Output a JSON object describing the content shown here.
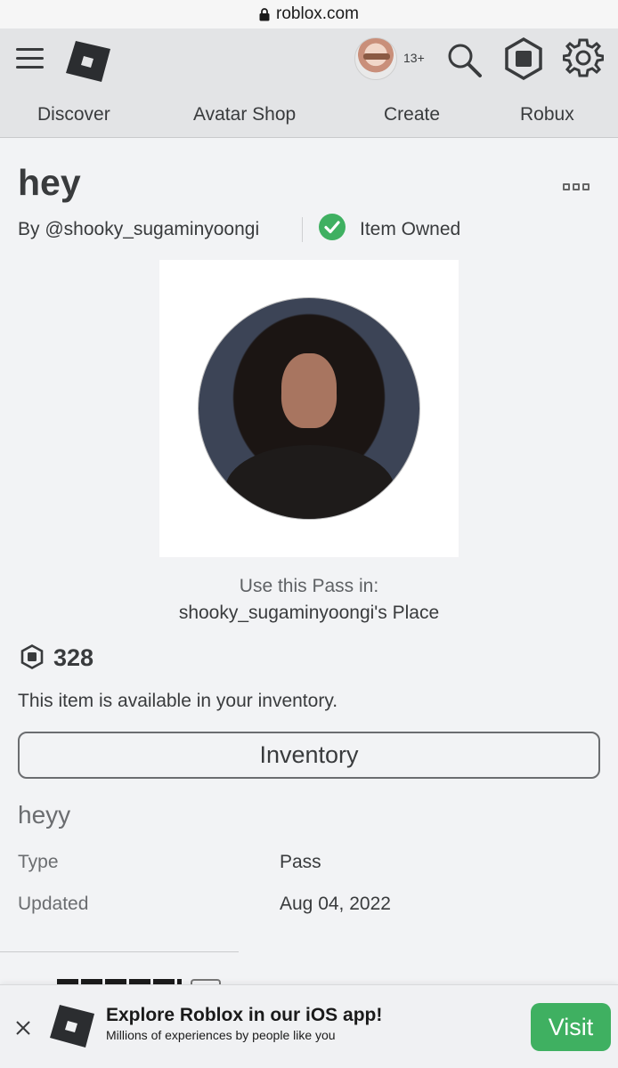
{
  "browser": {
    "url": "roblox.com"
  },
  "header": {
    "age_badge": "13+"
  },
  "nav": {
    "tabs": [
      "Discover",
      "Avatar Shop",
      "Create",
      "Robux"
    ]
  },
  "item": {
    "title": "hey",
    "creator": "By @shooky_sugaminyoongi",
    "owned_label": "Item Owned",
    "use_pass_label": "Use this Pass in:",
    "place_name": "shooky_sugaminyoongi's Place",
    "price": "328",
    "availability": "This item is available in your inventory.",
    "inventory_button": "Inventory",
    "description": "heyy",
    "details": [
      {
        "label": "Type",
        "value": "Pass"
      },
      {
        "label": "Updated",
        "value": "Aug 04, 2022"
      }
    ]
  },
  "banner": {
    "title": "Explore Roblox in our iOS app!",
    "subtitle": "Millions of experiences by people like you",
    "visit_label": "Visit"
  },
  "colors": {
    "accent_green": "#3fb061",
    "header_bg": "#e3e4e6",
    "page_bg": "#f2f3f5"
  },
  "icons": [
    "lock-icon",
    "menu-icon",
    "roblox-logo-icon",
    "search-icon",
    "robux-icon",
    "gear-icon",
    "more-icon",
    "check-icon",
    "close-icon"
  ]
}
